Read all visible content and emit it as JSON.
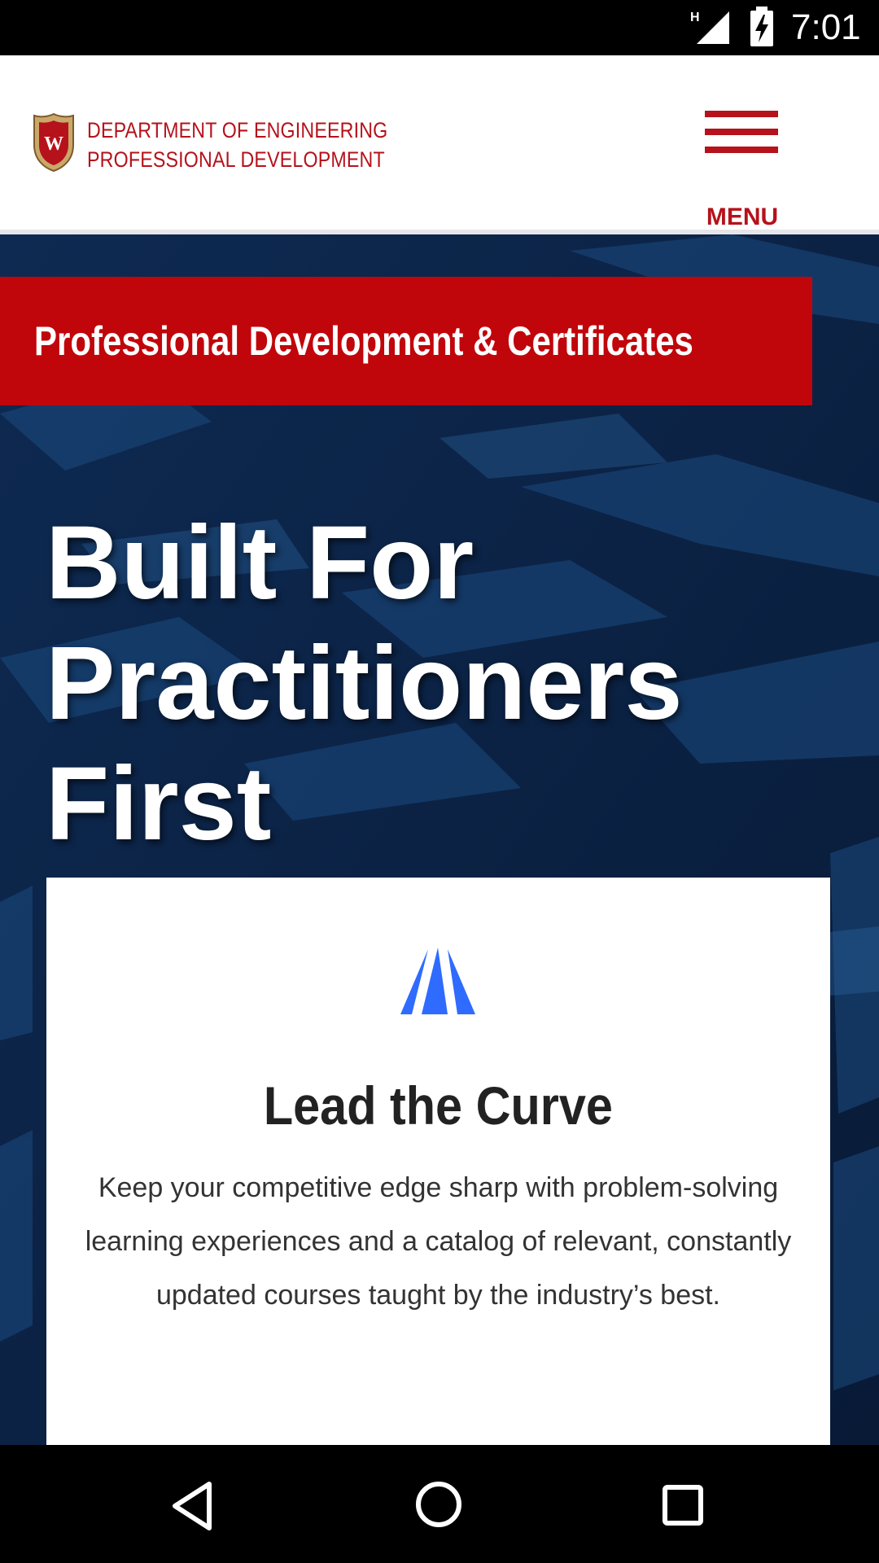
{
  "status_bar": {
    "network_indicator": "H",
    "time": "7:01",
    "icons": [
      "signal-icon",
      "battery-charging-icon"
    ]
  },
  "header": {
    "logo_icon": "uw-crest-icon",
    "dept_line1": "DEPARTMENT OF ENGINEERING",
    "dept_line2": "PROFESSIONAL DEVELOPMENT",
    "menu_label": "MENU",
    "brand_color": "#b5121b"
  },
  "hero": {
    "banner": "Professional Development & Certificates",
    "title_lines": [
      "Built For",
      "Practitioners",
      "First"
    ],
    "banner_color": "#c0060b",
    "background_color": "#0b2448"
  },
  "card": {
    "icon": "curve-peak-icon",
    "title": "Lead the Curve",
    "body": "Keep your competitive edge sharp with problem-solving learning experiences and a catalog of relevant, constantly updated courses taught by the industry’s best.",
    "icon_color": "#2f6bff"
  },
  "nav_bar": {
    "icons": [
      "back-icon",
      "home-icon",
      "recents-icon"
    ]
  }
}
